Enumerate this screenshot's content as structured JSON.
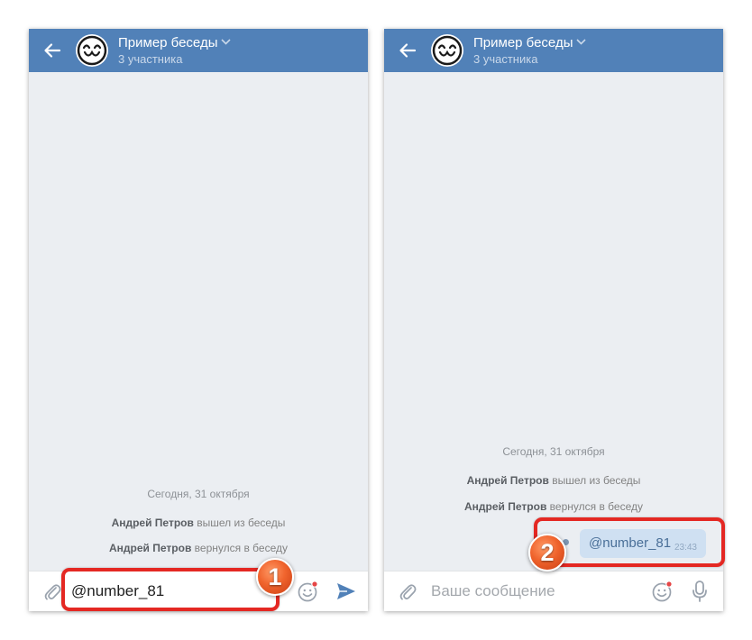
{
  "conversation": {
    "title": "Пример беседы",
    "subtitle": "3 участника"
  },
  "events": {
    "date": "Сегодня, 31 октября",
    "left_name": "Андрей Петров",
    "left_action": " вышел из беседы",
    "returned_name": "Андрей Петров",
    "returned_action": " вернулся в беседу"
  },
  "left_screen": {
    "input_value": "@number_81"
  },
  "right_screen": {
    "input_placeholder": "Ваше сообщение",
    "message_text": "@number_81",
    "message_time": "23:43"
  },
  "annotations": {
    "step1": "1",
    "step2": "2"
  },
  "colors": {
    "header": "#5181b8",
    "highlight": "#e42823",
    "badge": "#f0642d",
    "send": "#5181b8"
  },
  "icons": [
    "back-arrow-icon",
    "avatar-face-icon",
    "chevron-down-icon",
    "paperclip-icon",
    "emoji-icon",
    "send-icon",
    "microphone-icon"
  ]
}
